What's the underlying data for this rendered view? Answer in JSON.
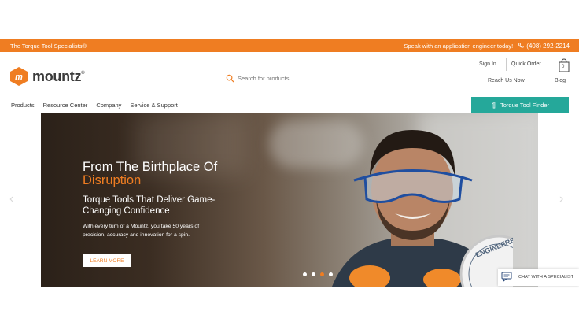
{
  "topbar": {
    "tagline": "The Torque Tool Specialists®",
    "cta": "Speak with an application engineer today!",
    "phone": "(408) 292-2214"
  },
  "header": {
    "logo_text": "mountz",
    "logo_mark": "®",
    "search_placeholder": "Search for products",
    "sign_in": "Sign In",
    "quick_order": "Quick Order",
    "reach_us": "Reach Us Now",
    "blog": "Blog",
    "cart_count": "0"
  },
  "nav": {
    "items": [
      "Products",
      "Resource Center",
      "Company",
      "Service & Support"
    ],
    "finder_label": "Torque Tool Finder"
  },
  "hero": {
    "title_line1": "From The Birthplace Of",
    "title_line2": "Disruption",
    "subtitle": "Torque Tools That Deliver Game-Changing Confidence",
    "body": "With every turn of a Mountz, you take 50 years of precision, accuracy and innovation for a spin.",
    "cta": "LEARN MORE",
    "badge_text": "ENGINEERED IN SILICON",
    "slide_count": 4,
    "active_slide": 3
  },
  "chat": {
    "label": "CHAT WITH A SPECIALIST"
  },
  "colors": {
    "accent": "#ef7d22",
    "teal": "#25a89a",
    "text": "#333333"
  }
}
